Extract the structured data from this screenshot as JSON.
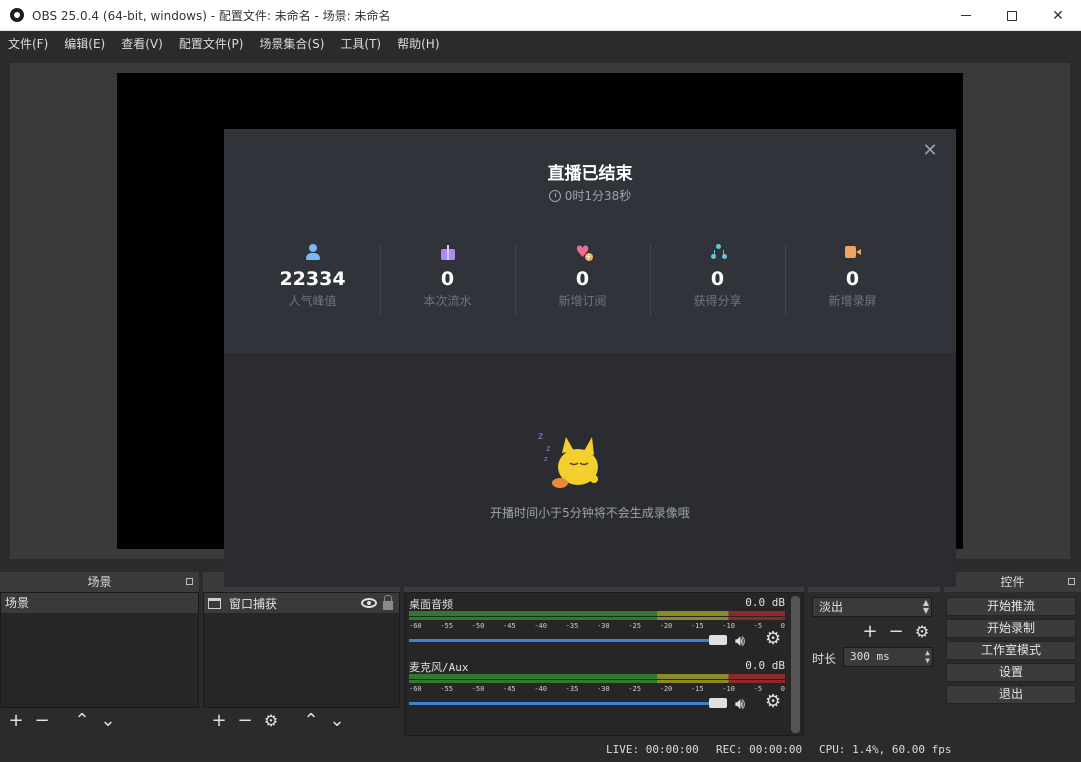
{
  "window": {
    "title": "OBS 25.0.4 (64-bit, windows) - 配置文件: 未命名 - 场景: 未命名",
    "minimize": "—",
    "close": "✕"
  },
  "menu": [
    "文件(F)",
    "编辑(E)",
    "查看(V)",
    "配置文件(P)",
    "场景集合(S)",
    "工具(T)",
    "帮助(H)"
  ],
  "modal": {
    "close": "✕",
    "title": "直播已结束",
    "duration": "0时1分38秒",
    "stats": [
      {
        "value": "22334",
        "label": "人气峰值"
      },
      {
        "value": "0",
        "label": "本次流水"
      },
      {
        "value": "0",
        "label": "新增订阅"
      },
      {
        "value": "0",
        "label": "获得分享"
      },
      {
        "value": "0",
        "label": "新增录屏"
      }
    ],
    "note": "开播时间小于5分钟将不会生成录像哦"
  },
  "scenes": {
    "header": "场景",
    "items": [
      "场景"
    ]
  },
  "sources": {
    "items": [
      "窗口捕获"
    ]
  },
  "mixer": {
    "tracks": [
      {
        "name": "桌面音频",
        "db": "0.0 dB"
      },
      {
        "name": "麦克风/Aux",
        "db": "0.0 dB"
      }
    ],
    "ticks": [
      "-60",
      "-55",
      "-50",
      "-45",
      "-40",
      "-35",
      "-30",
      "-25",
      "-20",
      "-15",
      "-10",
      "-5",
      "0"
    ]
  },
  "transitions": {
    "selected": "淡出",
    "duration_label": "时长",
    "duration_value": "300 ms"
  },
  "controls": {
    "header": "控件",
    "buttons": [
      "开始推流",
      "开始录制",
      "工作室模式",
      "设置",
      "退出"
    ]
  },
  "status": {
    "live": "LIVE: 00:00:00",
    "rec": "REC: 00:00:00",
    "cpu": "CPU: 1.4%, 60.00 fps"
  },
  "colors": {
    "accent_slider": "#3b82d6",
    "modal_bg": "#2a2c31",
    "modal_top": "#30333a"
  },
  "icons": [
    "user-icon",
    "gift-icon",
    "heart-plus-icon",
    "share-icon",
    "video-icon",
    "clock-icon"
  ]
}
